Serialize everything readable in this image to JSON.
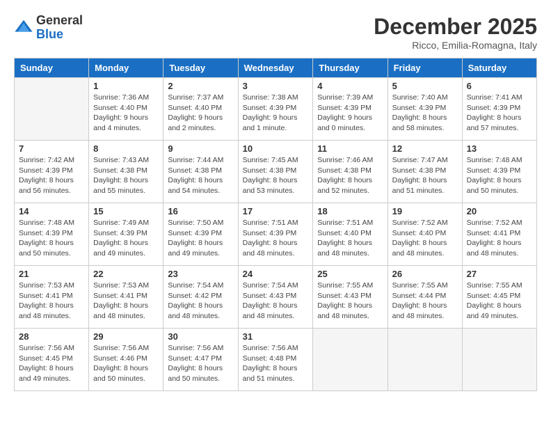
{
  "logo": {
    "general": "General",
    "blue": "Blue"
  },
  "title": "December 2025",
  "location": "Ricco, Emilia-Romagna, Italy",
  "days_header": [
    "Sunday",
    "Monday",
    "Tuesday",
    "Wednesday",
    "Thursday",
    "Friday",
    "Saturday"
  ],
  "weeks": [
    [
      {
        "day": "",
        "info": ""
      },
      {
        "day": "1",
        "info": "Sunrise: 7:36 AM\nSunset: 4:40 PM\nDaylight: 9 hours\nand 4 minutes."
      },
      {
        "day": "2",
        "info": "Sunrise: 7:37 AM\nSunset: 4:40 PM\nDaylight: 9 hours\nand 2 minutes."
      },
      {
        "day": "3",
        "info": "Sunrise: 7:38 AM\nSunset: 4:39 PM\nDaylight: 9 hours\nand 1 minute."
      },
      {
        "day": "4",
        "info": "Sunrise: 7:39 AM\nSunset: 4:39 PM\nDaylight: 9 hours\nand 0 minutes."
      },
      {
        "day": "5",
        "info": "Sunrise: 7:40 AM\nSunset: 4:39 PM\nDaylight: 8 hours\nand 58 minutes."
      },
      {
        "day": "6",
        "info": "Sunrise: 7:41 AM\nSunset: 4:39 PM\nDaylight: 8 hours\nand 57 minutes."
      }
    ],
    [
      {
        "day": "7",
        "info": "Sunrise: 7:42 AM\nSunset: 4:39 PM\nDaylight: 8 hours\nand 56 minutes."
      },
      {
        "day": "8",
        "info": "Sunrise: 7:43 AM\nSunset: 4:38 PM\nDaylight: 8 hours\nand 55 minutes."
      },
      {
        "day": "9",
        "info": "Sunrise: 7:44 AM\nSunset: 4:38 PM\nDaylight: 8 hours\nand 54 minutes."
      },
      {
        "day": "10",
        "info": "Sunrise: 7:45 AM\nSunset: 4:38 PM\nDaylight: 8 hours\nand 53 minutes."
      },
      {
        "day": "11",
        "info": "Sunrise: 7:46 AM\nSunset: 4:38 PM\nDaylight: 8 hours\nand 52 minutes."
      },
      {
        "day": "12",
        "info": "Sunrise: 7:47 AM\nSunset: 4:38 PM\nDaylight: 8 hours\nand 51 minutes."
      },
      {
        "day": "13",
        "info": "Sunrise: 7:48 AM\nSunset: 4:39 PM\nDaylight: 8 hours\nand 50 minutes."
      }
    ],
    [
      {
        "day": "14",
        "info": "Sunrise: 7:48 AM\nSunset: 4:39 PM\nDaylight: 8 hours\nand 50 minutes."
      },
      {
        "day": "15",
        "info": "Sunrise: 7:49 AM\nSunset: 4:39 PM\nDaylight: 8 hours\nand 49 minutes."
      },
      {
        "day": "16",
        "info": "Sunrise: 7:50 AM\nSunset: 4:39 PM\nDaylight: 8 hours\nand 49 minutes."
      },
      {
        "day": "17",
        "info": "Sunrise: 7:51 AM\nSunset: 4:39 PM\nDaylight: 8 hours\nand 48 minutes."
      },
      {
        "day": "18",
        "info": "Sunrise: 7:51 AM\nSunset: 4:40 PM\nDaylight: 8 hours\nand 48 minutes."
      },
      {
        "day": "19",
        "info": "Sunrise: 7:52 AM\nSunset: 4:40 PM\nDaylight: 8 hours\nand 48 minutes."
      },
      {
        "day": "20",
        "info": "Sunrise: 7:52 AM\nSunset: 4:41 PM\nDaylight: 8 hours\nand 48 minutes."
      }
    ],
    [
      {
        "day": "21",
        "info": "Sunrise: 7:53 AM\nSunset: 4:41 PM\nDaylight: 8 hours\nand 48 minutes."
      },
      {
        "day": "22",
        "info": "Sunrise: 7:53 AM\nSunset: 4:41 PM\nDaylight: 8 hours\nand 48 minutes."
      },
      {
        "day": "23",
        "info": "Sunrise: 7:54 AM\nSunset: 4:42 PM\nDaylight: 8 hours\nand 48 minutes."
      },
      {
        "day": "24",
        "info": "Sunrise: 7:54 AM\nSunset: 4:43 PM\nDaylight: 8 hours\nand 48 minutes."
      },
      {
        "day": "25",
        "info": "Sunrise: 7:55 AM\nSunset: 4:43 PM\nDaylight: 8 hours\nand 48 minutes."
      },
      {
        "day": "26",
        "info": "Sunrise: 7:55 AM\nSunset: 4:44 PM\nDaylight: 8 hours\nand 48 minutes."
      },
      {
        "day": "27",
        "info": "Sunrise: 7:55 AM\nSunset: 4:45 PM\nDaylight: 8 hours\nand 49 minutes."
      }
    ],
    [
      {
        "day": "28",
        "info": "Sunrise: 7:56 AM\nSunset: 4:45 PM\nDaylight: 8 hours\nand 49 minutes."
      },
      {
        "day": "29",
        "info": "Sunrise: 7:56 AM\nSunset: 4:46 PM\nDaylight: 8 hours\nand 50 minutes."
      },
      {
        "day": "30",
        "info": "Sunrise: 7:56 AM\nSunset: 4:47 PM\nDaylight: 8 hours\nand 50 minutes."
      },
      {
        "day": "31",
        "info": "Sunrise: 7:56 AM\nSunset: 4:48 PM\nDaylight: 8 hours\nand 51 minutes."
      },
      {
        "day": "",
        "info": ""
      },
      {
        "day": "",
        "info": ""
      },
      {
        "day": "",
        "info": ""
      }
    ]
  ]
}
